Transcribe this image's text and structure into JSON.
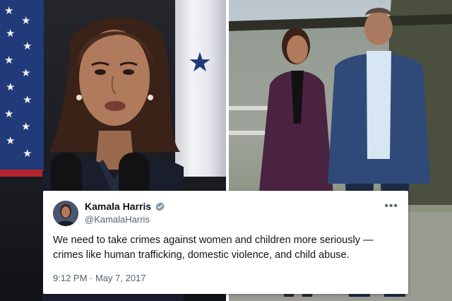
{
  "tweet": {
    "display_name": "Kamala Harris",
    "handle": "@KamalaHarris",
    "verified": true,
    "text": "We need to take crimes against women and children more seriously — crimes like human trafficking, domestic violence, and child abuse.",
    "timestamp": "9:12 PM · May 7, 2017",
    "more_icon": "more-horizontal-icon",
    "verified_icon": "verified-badge-icon"
  },
  "colors": {
    "card_bg": "#ffffff",
    "text_primary": "#0f1419",
    "text_secondary": "#536471",
    "verified": "#829aab",
    "divider": "#ffffff"
  }
}
